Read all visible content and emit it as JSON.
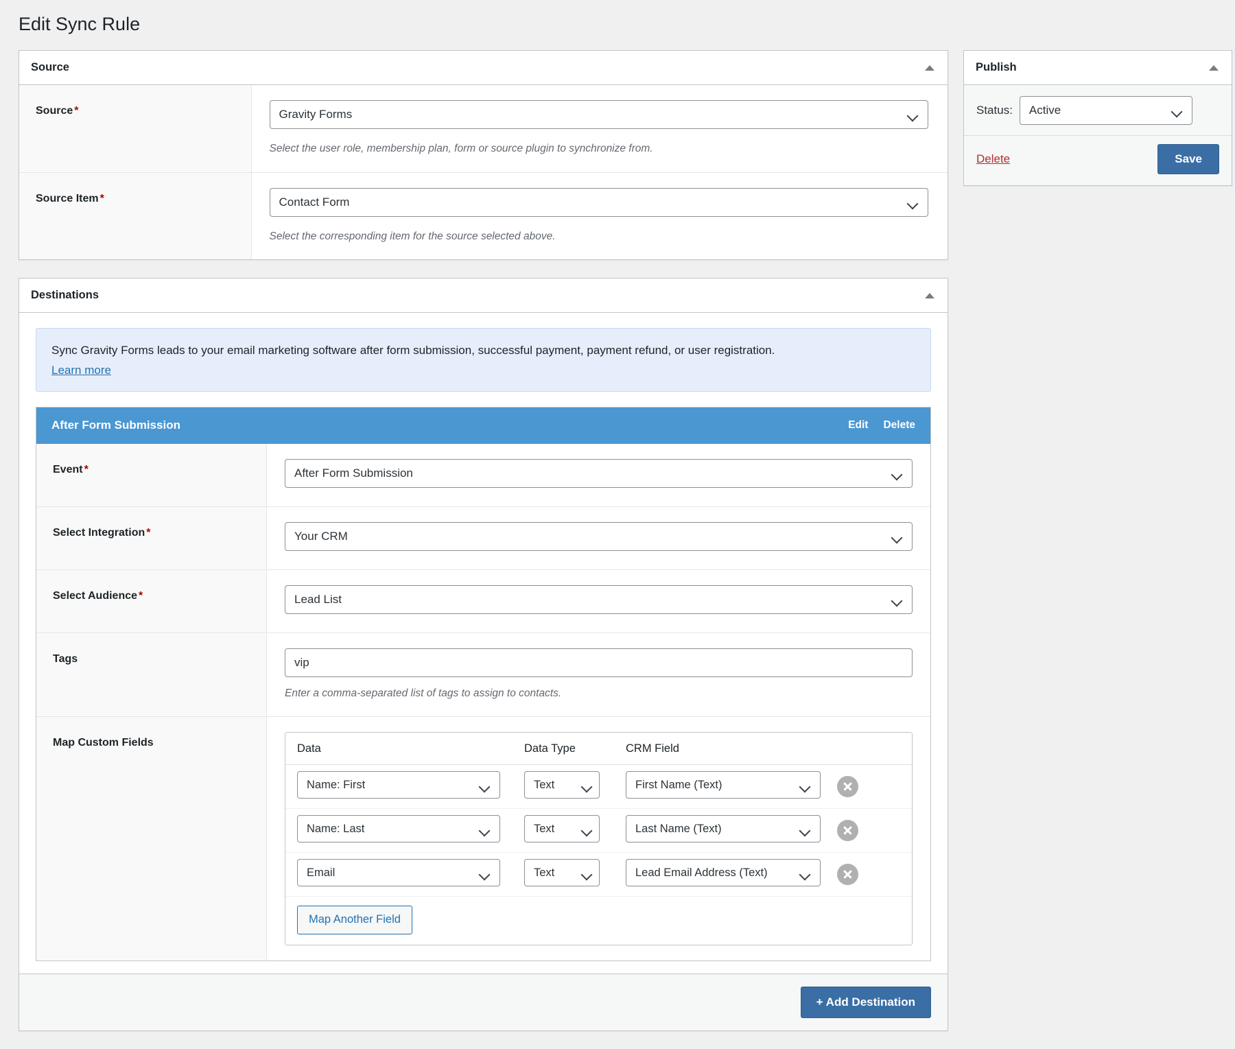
{
  "page": {
    "title": "Edit Sync Rule"
  },
  "source_panel": {
    "heading": "Source",
    "toggle_icon": "caret-up-icon",
    "rows": [
      {
        "label": "Source",
        "required": "*",
        "value": "Gravity Forms",
        "description": "Select the user role, membership plan, form or source plugin to synchronize from."
      },
      {
        "label": "Source Item",
        "required": "*",
        "value": "Contact Form",
        "description": "Select the corresponding item for the source selected above."
      }
    ]
  },
  "destinations_panel": {
    "heading": "Destinations",
    "toggle_icon": "caret-up-icon",
    "notice": {
      "text": "Sync Gravity Forms leads to your email marketing software after form submission, successful payment, payment refund, or user registration.",
      "link_label": "Learn more"
    },
    "destination": {
      "title": "After Form Submission",
      "edit_label": "Edit",
      "delete_label": "Delete",
      "rows": {
        "event": {
          "label": "Event",
          "required": "*",
          "value": "After Form Submission"
        },
        "integration": {
          "label": "Select Integration",
          "required": "*",
          "value": "Your CRM"
        },
        "audience": {
          "label": "Select Audience",
          "required": "*",
          "value": "Lead List"
        },
        "tags": {
          "label": "Tags",
          "value": "vip",
          "placeholder": "",
          "description": "Enter a comma-separated list of tags to assign to contacts."
        },
        "map_fields": {
          "label": "Map Custom Fields",
          "columns": [
            "Data",
            "Data Type",
            "CRM Field"
          ],
          "rows": [
            {
              "data": "Name: First",
              "data_type": "Text",
              "crm_field": "First Name (Text)",
              "remove_icon": "remove-circle-icon"
            },
            {
              "data": "Name: Last",
              "data_type": "Text",
              "crm_field": "Last Name (Text)",
              "remove_icon": "remove-circle-icon"
            },
            {
              "data": "Email",
              "data_type": "Text",
              "crm_field": "Lead Email Address (Text)",
              "remove_icon": "remove-circle-icon"
            }
          ],
          "add_button": "Map Another Field"
        }
      }
    },
    "add_destination_label": "+ Add Destination"
  },
  "publish_panel": {
    "heading": "Publish",
    "toggle_icon": "caret-up-icon",
    "status_label": "Status:",
    "status_value": "Active",
    "delete_label": "Delete",
    "save_label": "Save"
  },
  "colors": {
    "accent_blue": "#3a6ea5",
    "header_blue": "#4a97d2",
    "notice_bg": "#e7eefb",
    "link_blue": "#2271b1",
    "danger_red": "#b32d2e",
    "required_red": "#aa0000"
  }
}
